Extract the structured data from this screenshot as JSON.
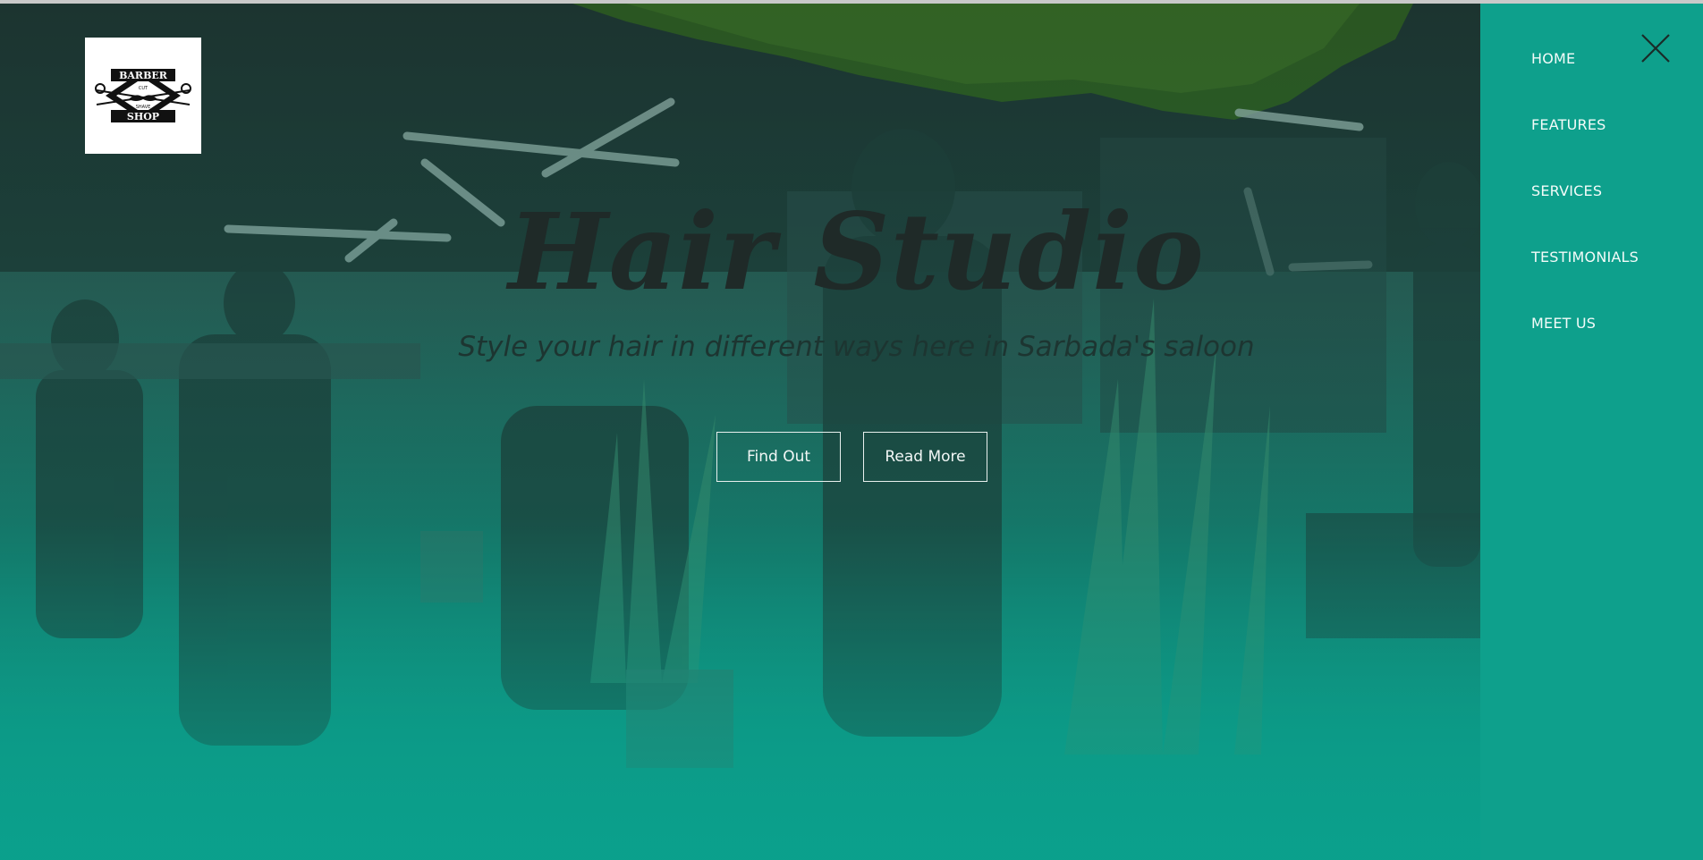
{
  "logo": {
    "alt": "Barber Shop logo",
    "word_top": "BARBER",
    "word_bottom": "SHOP",
    "small_left": "CUT",
    "small_right": "SHAVE"
  },
  "hero": {
    "title": "Hair Studio",
    "subtitle": "Style your hair in different ways here in Sarbada's saloon",
    "buttons": {
      "find_out": "Find Out",
      "read_more": "Read More"
    }
  },
  "nav": {
    "items": [
      "HOME",
      "FEATURES",
      "SERVICES",
      "TESTIMONIALS",
      "MEET US"
    ]
  },
  "colors": {
    "accent": "#0ea08c",
    "title": "#1f2a28",
    "panel_text": "#f3fbf9"
  },
  "icons": {
    "close": "close-icon"
  }
}
